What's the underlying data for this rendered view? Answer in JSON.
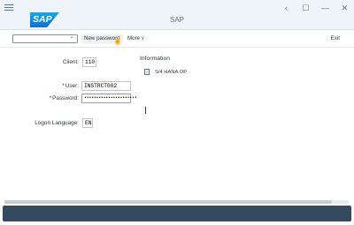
{
  "window": {
    "title": "SAP",
    "logo_text": "SAP",
    "controls": [
      "back-icon",
      "lock-icon",
      "minimize-icon",
      "close-icon"
    ]
  },
  "toolbar": {
    "transaction_value": "",
    "new_password_label": "New password",
    "more_label": "More",
    "exit_label": "Exit"
  },
  "form": {
    "client_label": "Client:",
    "client_value": "110",
    "user_label": "User:",
    "user_value": "INSTRCT002",
    "password_label": "Password:",
    "password_value": "••••••••••••••••••••••",
    "language_label": "Logon Language:",
    "language_value": "EN",
    "required_marker": "*"
  },
  "information": {
    "title": "Information",
    "items": [
      {
        "icon": "document-icon",
        "text": "S/4 HANA OP"
      }
    ]
  },
  "colors": {
    "titlebar_bg": "#eff4f9",
    "logo_blue": "#0a6ed1",
    "statusbar_bg": "#354a5f",
    "required": "#bb0000"
  }
}
